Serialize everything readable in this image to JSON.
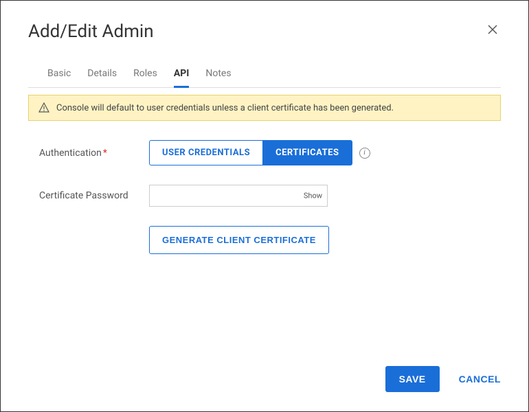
{
  "modal": {
    "title": "Add/Edit Admin"
  },
  "tabs": {
    "basic": "Basic",
    "details": "Details",
    "roles": "Roles",
    "api": "API",
    "notes": "Notes"
  },
  "alert": {
    "message": "Console will default to user credentials unless a client certificate has been generated."
  },
  "form": {
    "auth_label": "Authentication",
    "auth_option_user": "USER CREDENTIALS",
    "auth_option_cert": "CERTIFICATES",
    "cert_pw_label": "Certificate Password",
    "cert_pw_value": "",
    "cert_pw_show": "Show",
    "generate_label": "GENERATE CLIENT CERTIFICATE"
  },
  "footer": {
    "save": "SAVE",
    "cancel": "CANCEL"
  }
}
